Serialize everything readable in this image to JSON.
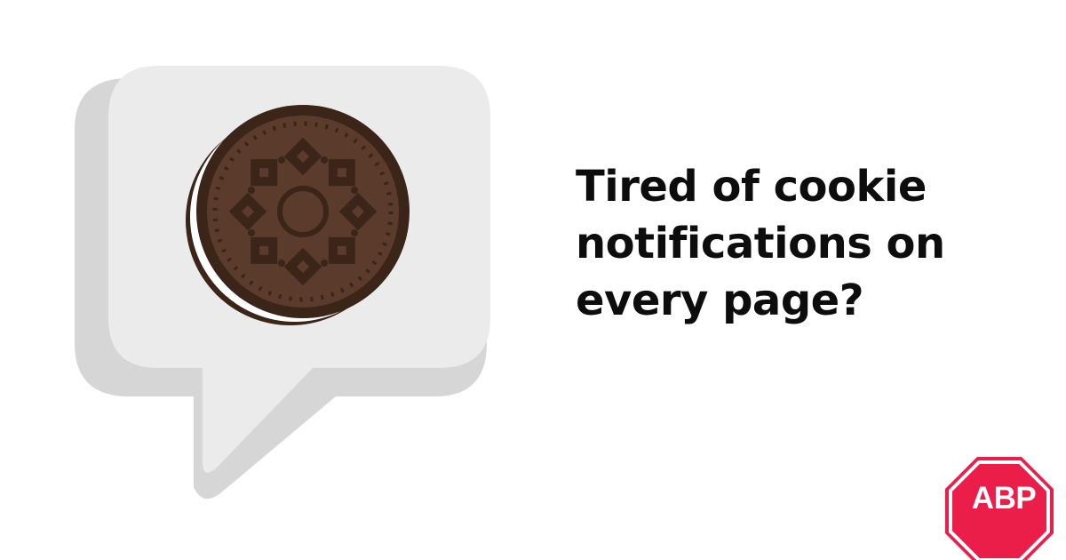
{
  "headline": {
    "line1": "Tired of cookie",
    "line2": "notifications on",
    "line3": "every page?"
  },
  "logo": {
    "text": "ABP",
    "color": "#ea1e48"
  },
  "icons": [
    "speech-bubble-icon",
    "cookie-icon",
    "abp-logo"
  ],
  "colors": {
    "bubble_face": "#ebebeb",
    "bubble_shadow": "#d6d6d6",
    "cookie_dark": "#3b2418",
    "cookie_mid": "#5a3b2c",
    "cream": "#ffffff",
    "text": "#0d0d0d"
  }
}
